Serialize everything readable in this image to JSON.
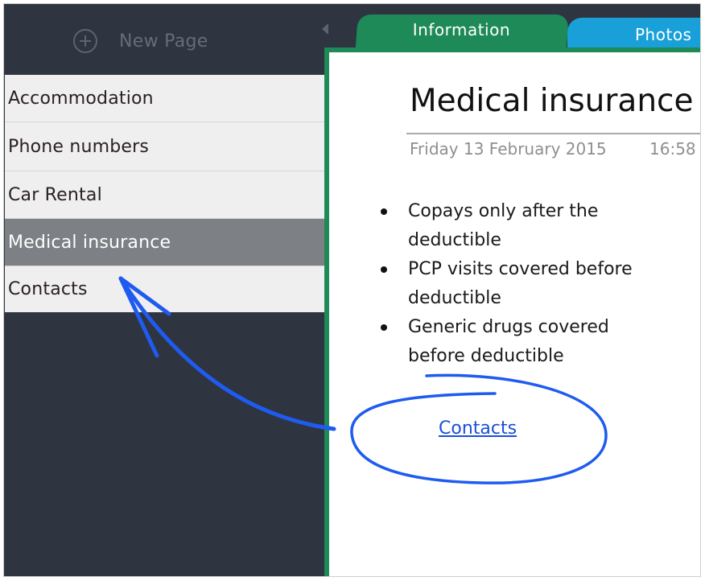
{
  "sidebar": {
    "new_page_label": "New Page",
    "items": [
      {
        "label": "Accommodation"
      },
      {
        "label": "Phone numbers"
      },
      {
        "label": "Car Rental"
      },
      {
        "label": "Medical insurance",
        "selected": true
      },
      {
        "label": "Contacts"
      }
    ]
  },
  "tabs": {
    "active": "Information",
    "other": "Photos"
  },
  "note": {
    "title": "Medical insurance",
    "date": "Friday 13 February 2015",
    "time": "16:58",
    "bullets": [
      "Copays only after the deductible",
      "PCP visits covered before deductible",
      "Generic drugs covered before deductible"
    ],
    "link_text": "Contacts"
  },
  "colors": {
    "sidebar_bg": "#2e3440",
    "selected_item": "#7d8185",
    "info_tab": "#1e8a58",
    "photos_tab": "#1aa0d8",
    "link": "#1a4fd6",
    "annotation": "#1f5bf0"
  }
}
